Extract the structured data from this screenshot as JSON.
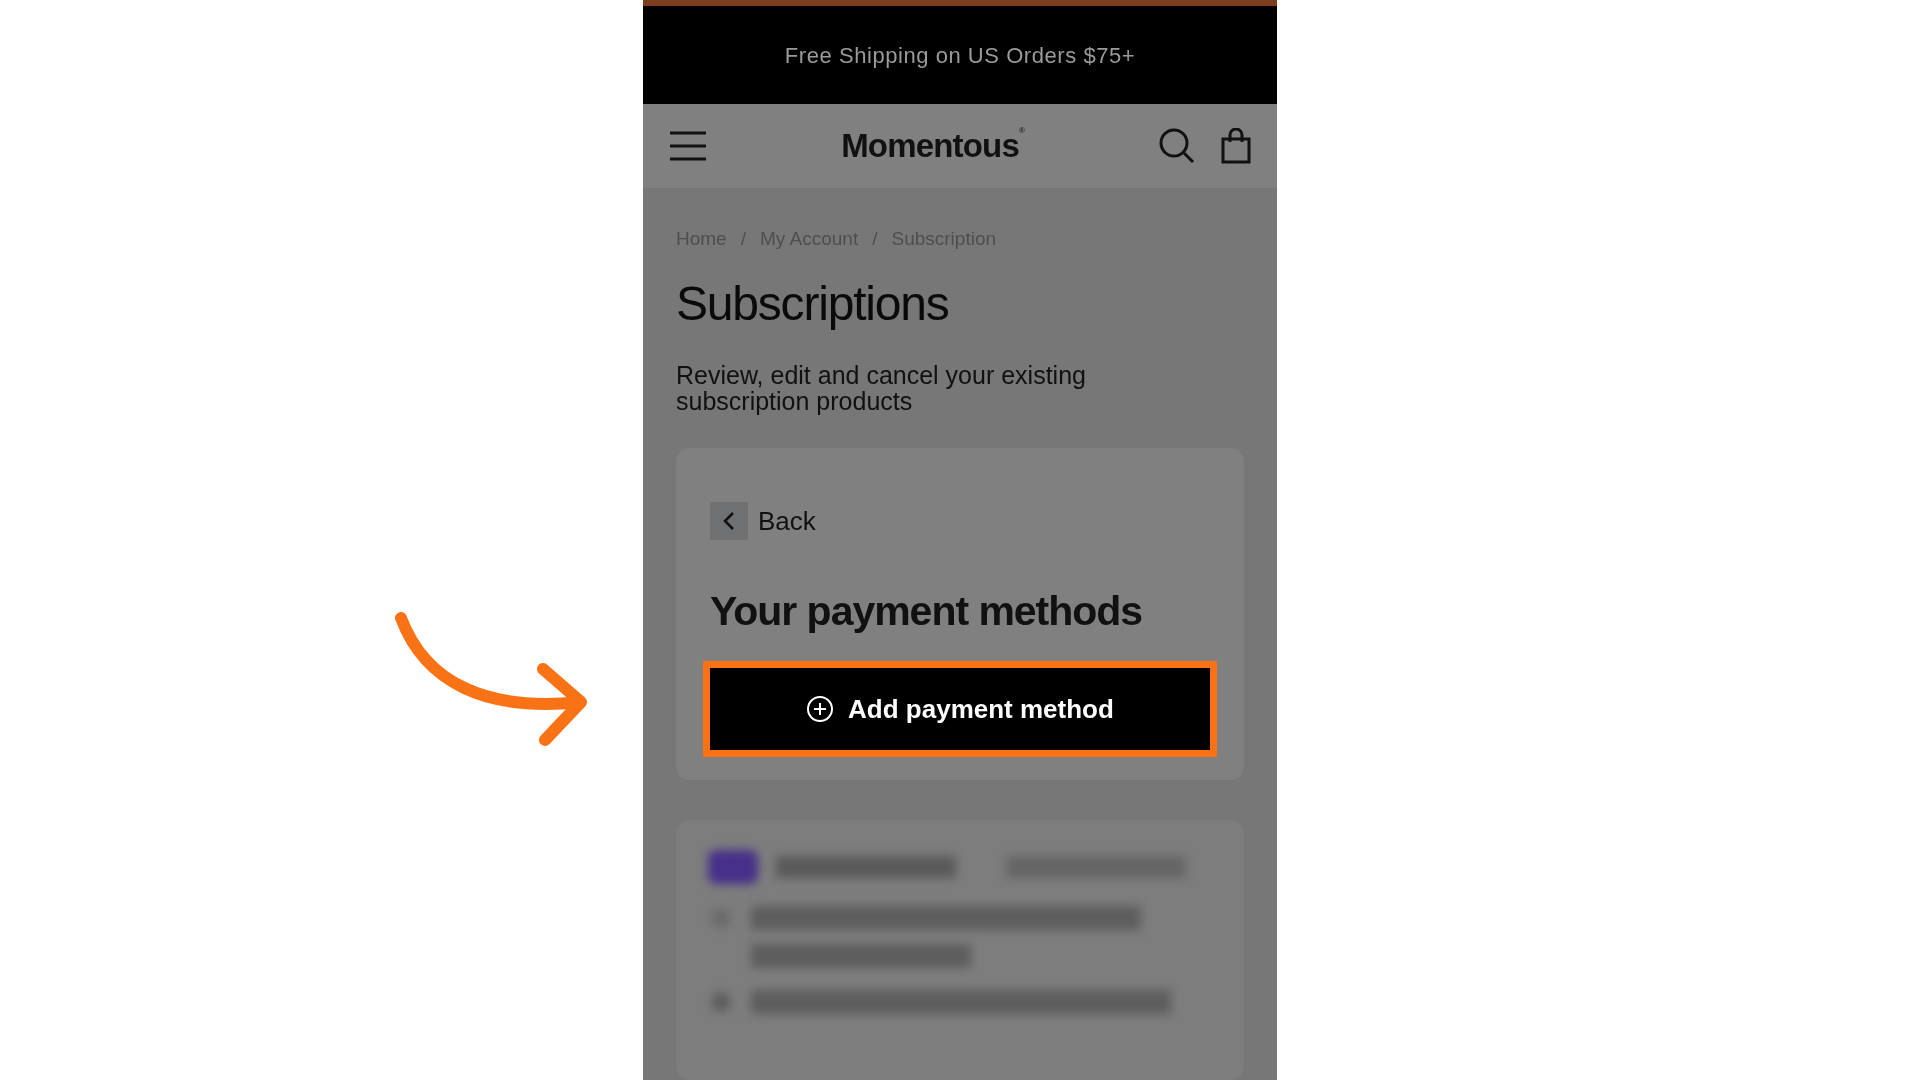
{
  "announcement_bar": {
    "text": "Free Shipping on US Orders $75+"
  },
  "header": {
    "logo": "Momentous",
    "logo_mark": "®"
  },
  "breadcrumb": [
    "Home",
    "My Account",
    "Subscription"
  ],
  "breadcrumb_separator": "/",
  "page": {
    "title": "Subscriptions",
    "description": "Review, edit and cancel your existing subscription products"
  },
  "payment_panel": {
    "back_label": "Back",
    "title": "Your payment methods",
    "add_button": "Add payment method",
    "highlighted": true
  }
}
